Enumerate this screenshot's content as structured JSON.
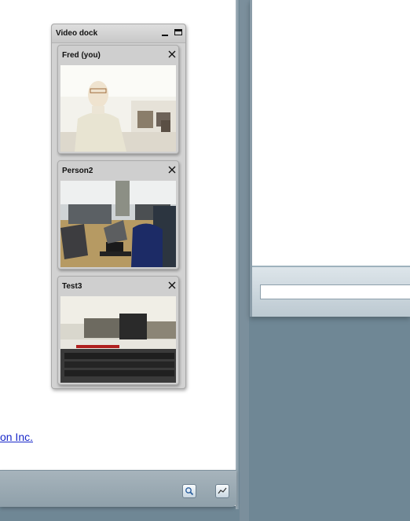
{
  "video_dock": {
    "title": "Video dock",
    "participants": [
      {
        "name": "Fred (you)"
      },
      {
        "name": "Person2"
      },
      {
        "name": "Test3"
      }
    ]
  },
  "background": {
    "link_text": "on Inc.",
    "chat_input_value": ""
  },
  "icons": {
    "dock_minimize": "minimize-icon",
    "dock_maximize": "maximize-icon",
    "tile_close": "close-icon",
    "bottom_left": "zoom-icon",
    "bottom_right": "chart-icon"
  },
  "colors": {
    "desktop": "#6f8795",
    "dock_bg": "#d2d2d2",
    "link": "#1a29c9"
  }
}
